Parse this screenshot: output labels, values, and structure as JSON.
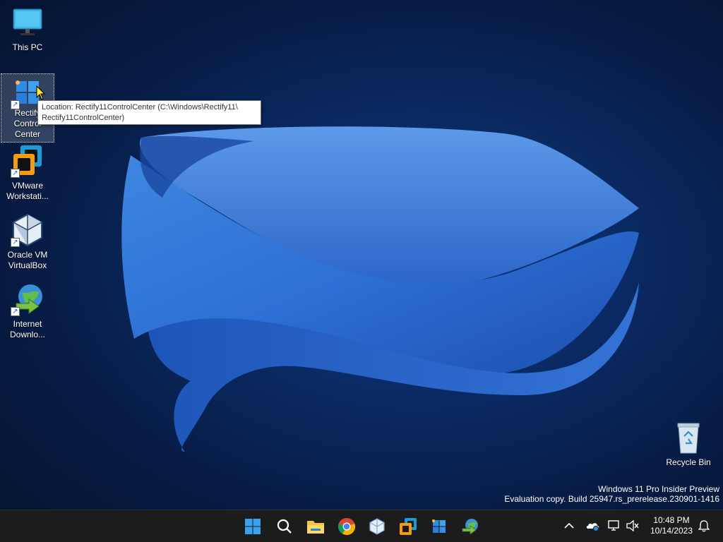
{
  "desktop": {
    "icons": [
      {
        "label": "This PC"
      },
      {
        "label": "Rectify11 Control Center",
        "label_lines": [
          "Rectify",
          "Control",
          "Center"
        ]
      },
      {
        "label": "VMware Workstati...",
        "label_lines": [
          "VMware",
          "Workstati..."
        ]
      },
      {
        "label": "Oracle VM VirtualBox",
        "label_lines": [
          "Oracle VM",
          "VirtualBox"
        ]
      },
      {
        "label": "Internet Downlo...",
        "label_lines": [
          "Internet",
          "Downlo..."
        ]
      },
      {
        "label": "Recycle Bin"
      }
    ],
    "tooltip": {
      "line1": "Location: Rectify11ControlCenter (C:\\Windows\\Rectify11\\",
      "line2": "Rectify11ControlCenter)"
    }
  },
  "watermark": {
    "line1": "Windows 11 Pro Insider Preview",
    "line2": "Evaluation copy. Build 25947.rs_prerelease.230901-1416"
  },
  "taskbar": {
    "apps": [
      "start-icon",
      "search-icon",
      "file-explorer-icon",
      "chrome-icon",
      "virtualbox-icon",
      "vmware-icon",
      "rectify11-icon",
      "internet-download-manager-icon"
    ],
    "tray": [
      "chevron-up-icon",
      "onedrive-icon",
      "network-icon",
      "volume-muted-icon"
    ],
    "clock": {
      "time": "10:48 PM",
      "date": "10/14/2023"
    }
  },
  "colors": {
    "accent": "#0a5ec8",
    "taskbar_bg": "#1c1c1c"
  }
}
